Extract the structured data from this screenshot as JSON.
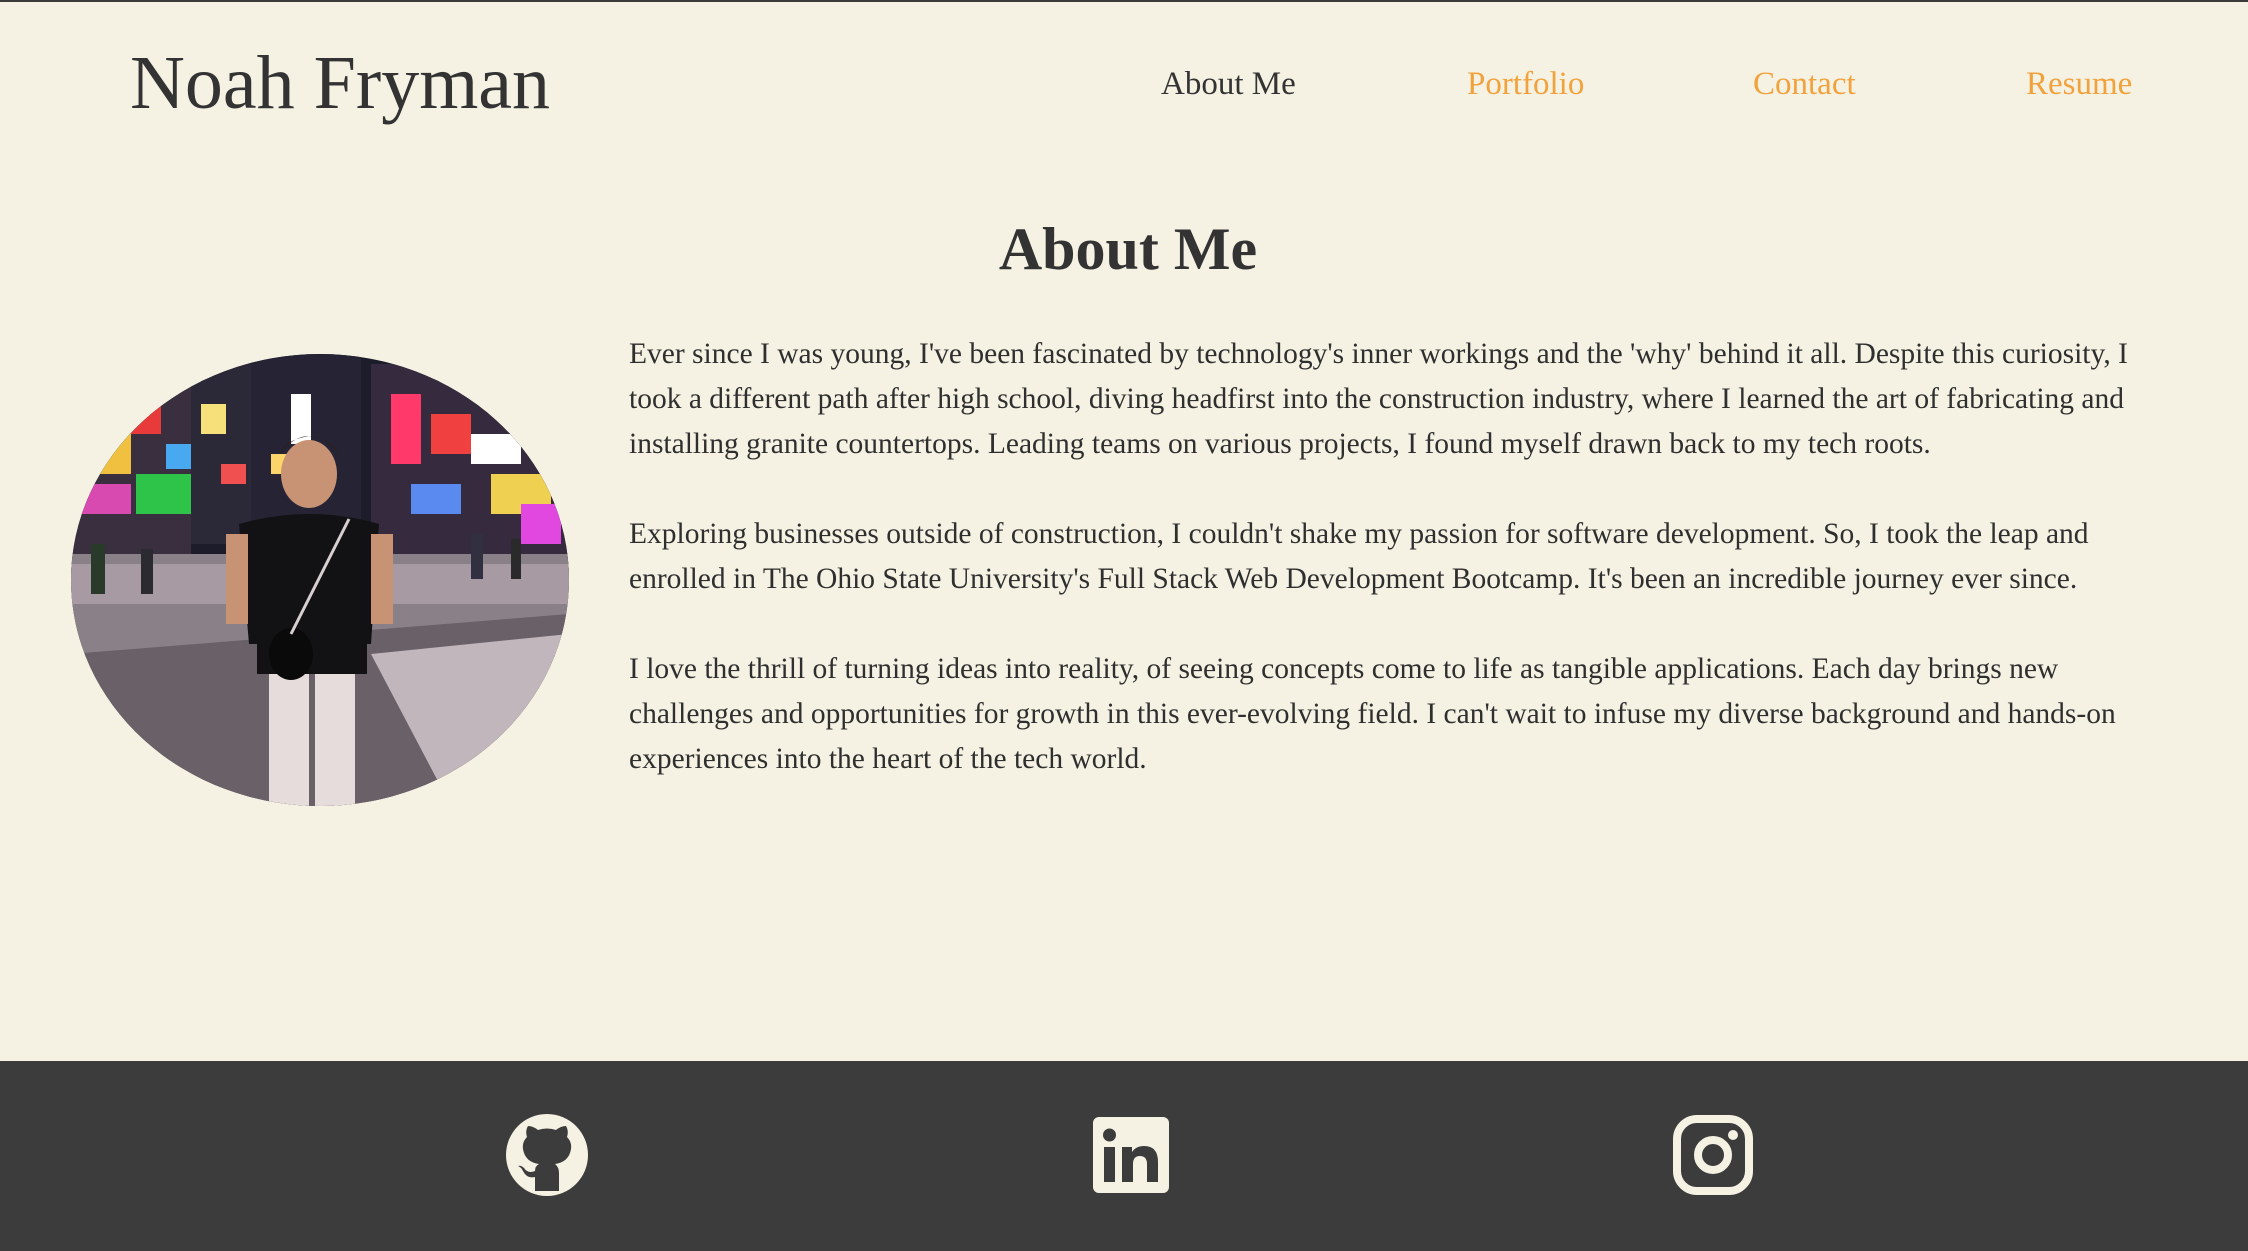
{
  "header": {
    "site_title": "Noah Fryman",
    "nav": [
      {
        "label": "About Me",
        "active": true
      },
      {
        "label": "Portfolio",
        "active": false
      },
      {
        "label": "Contact",
        "active": false
      },
      {
        "label": "Resume",
        "active": false
      }
    ]
  },
  "about": {
    "title": "About Me",
    "paragraphs": [
      "Ever since I was young, I've been fascinated by technology's inner workings and the 'why' behind it all. Despite this curiosity, I took a different path after high school, diving headfirst into the construction industry, where I learned the art of fabricating and installing granite countertops. Leading teams on various projects, I found myself drawn back to my tech roots.",
      "Exploring businesses outside of construction, I couldn't shake my passion for software development. So, I took the leap and enrolled in The Ohio State University's Full Stack Web Development Bootcamp. It's been an incredible journey ever since.",
      "I love the thrill of turning ideas into reality, of seeing concepts come to life as tangible applications. Each day brings new challenges and opportunities for growth in this ever-evolving field. I can't wait to infuse my diverse background and hands-on experiences into the heart of the tech world."
    ]
  },
  "footer": {
    "social": [
      {
        "icon": "github-icon"
      },
      {
        "icon": "linkedin-icon"
      },
      {
        "icon": "instagram-icon"
      }
    ]
  },
  "colors": {
    "background": "#f5f2e3",
    "accent": "#f2a23c",
    "text": "#333333",
    "footer": "#3c3c3c",
    "footer_icon": "#f5f2e3"
  }
}
